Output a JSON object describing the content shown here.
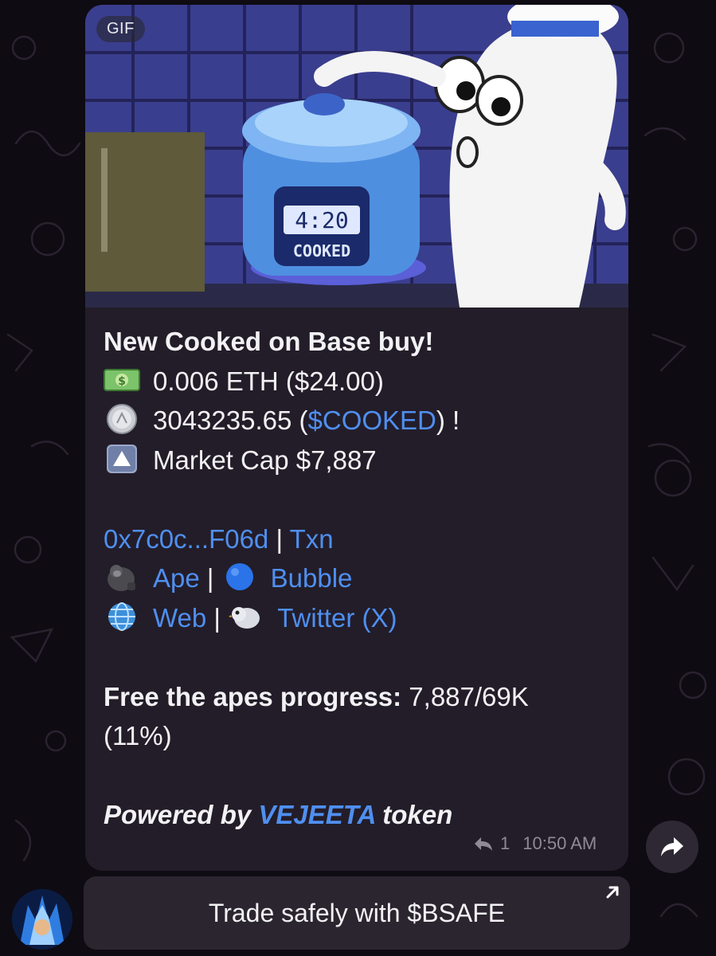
{
  "message": {
    "media_badge": "GIF",
    "cooker_display_time": "4:20",
    "cooker_display_word": "COOKED",
    "title": "New Cooked on Base buy!",
    "eth_amount": "0.006 ETH ($24.00)",
    "token_amount": "3043235.65 (",
    "token_symbol": "$COOKED",
    "token_suffix": ") !",
    "market_cap": "Market Cap $7,887",
    "address_link": "0x7c0c...F06d",
    "separator": " | ",
    "txn_link": "Txn",
    "ape_link": "Ape",
    "bubble_link": "Bubble",
    "web_link": "Web",
    "twitter_link": "Twitter (X)",
    "progress_label": "Free the apes progress:",
    "progress_value": " 7,887/69K",
    "progress_pct": "(11%)",
    "powered_prefix": "Powered by ",
    "powered_link": "VEJEETA",
    "powered_suffix": " token",
    "reply_count": "1",
    "time": "10:50 AM"
  },
  "keyboard_button": {
    "label": "Trade safely with $BSAFE"
  },
  "icons": {
    "money": "money-bill-emoji-icon",
    "coin": "coin-emoji-icon",
    "up": "up-arrow-button-emoji-icon",
    "ape": "gorilla-emoji-icon",
    "bubble": "blue-circle-emoji-icon",
    "web": "globe-emoji-icon",
    "twitter": "bird-emoji-icon",
    "reply": "reply-arrow-icon",
    "share": "share-arrow-icon",
    "external": "external-link-arrow-icon"
  },
  "colors": {
    "link": "#4f8ff0",
    "bubble_bg": "#231d29",
    "background": "#0e0b12"
  }
}
